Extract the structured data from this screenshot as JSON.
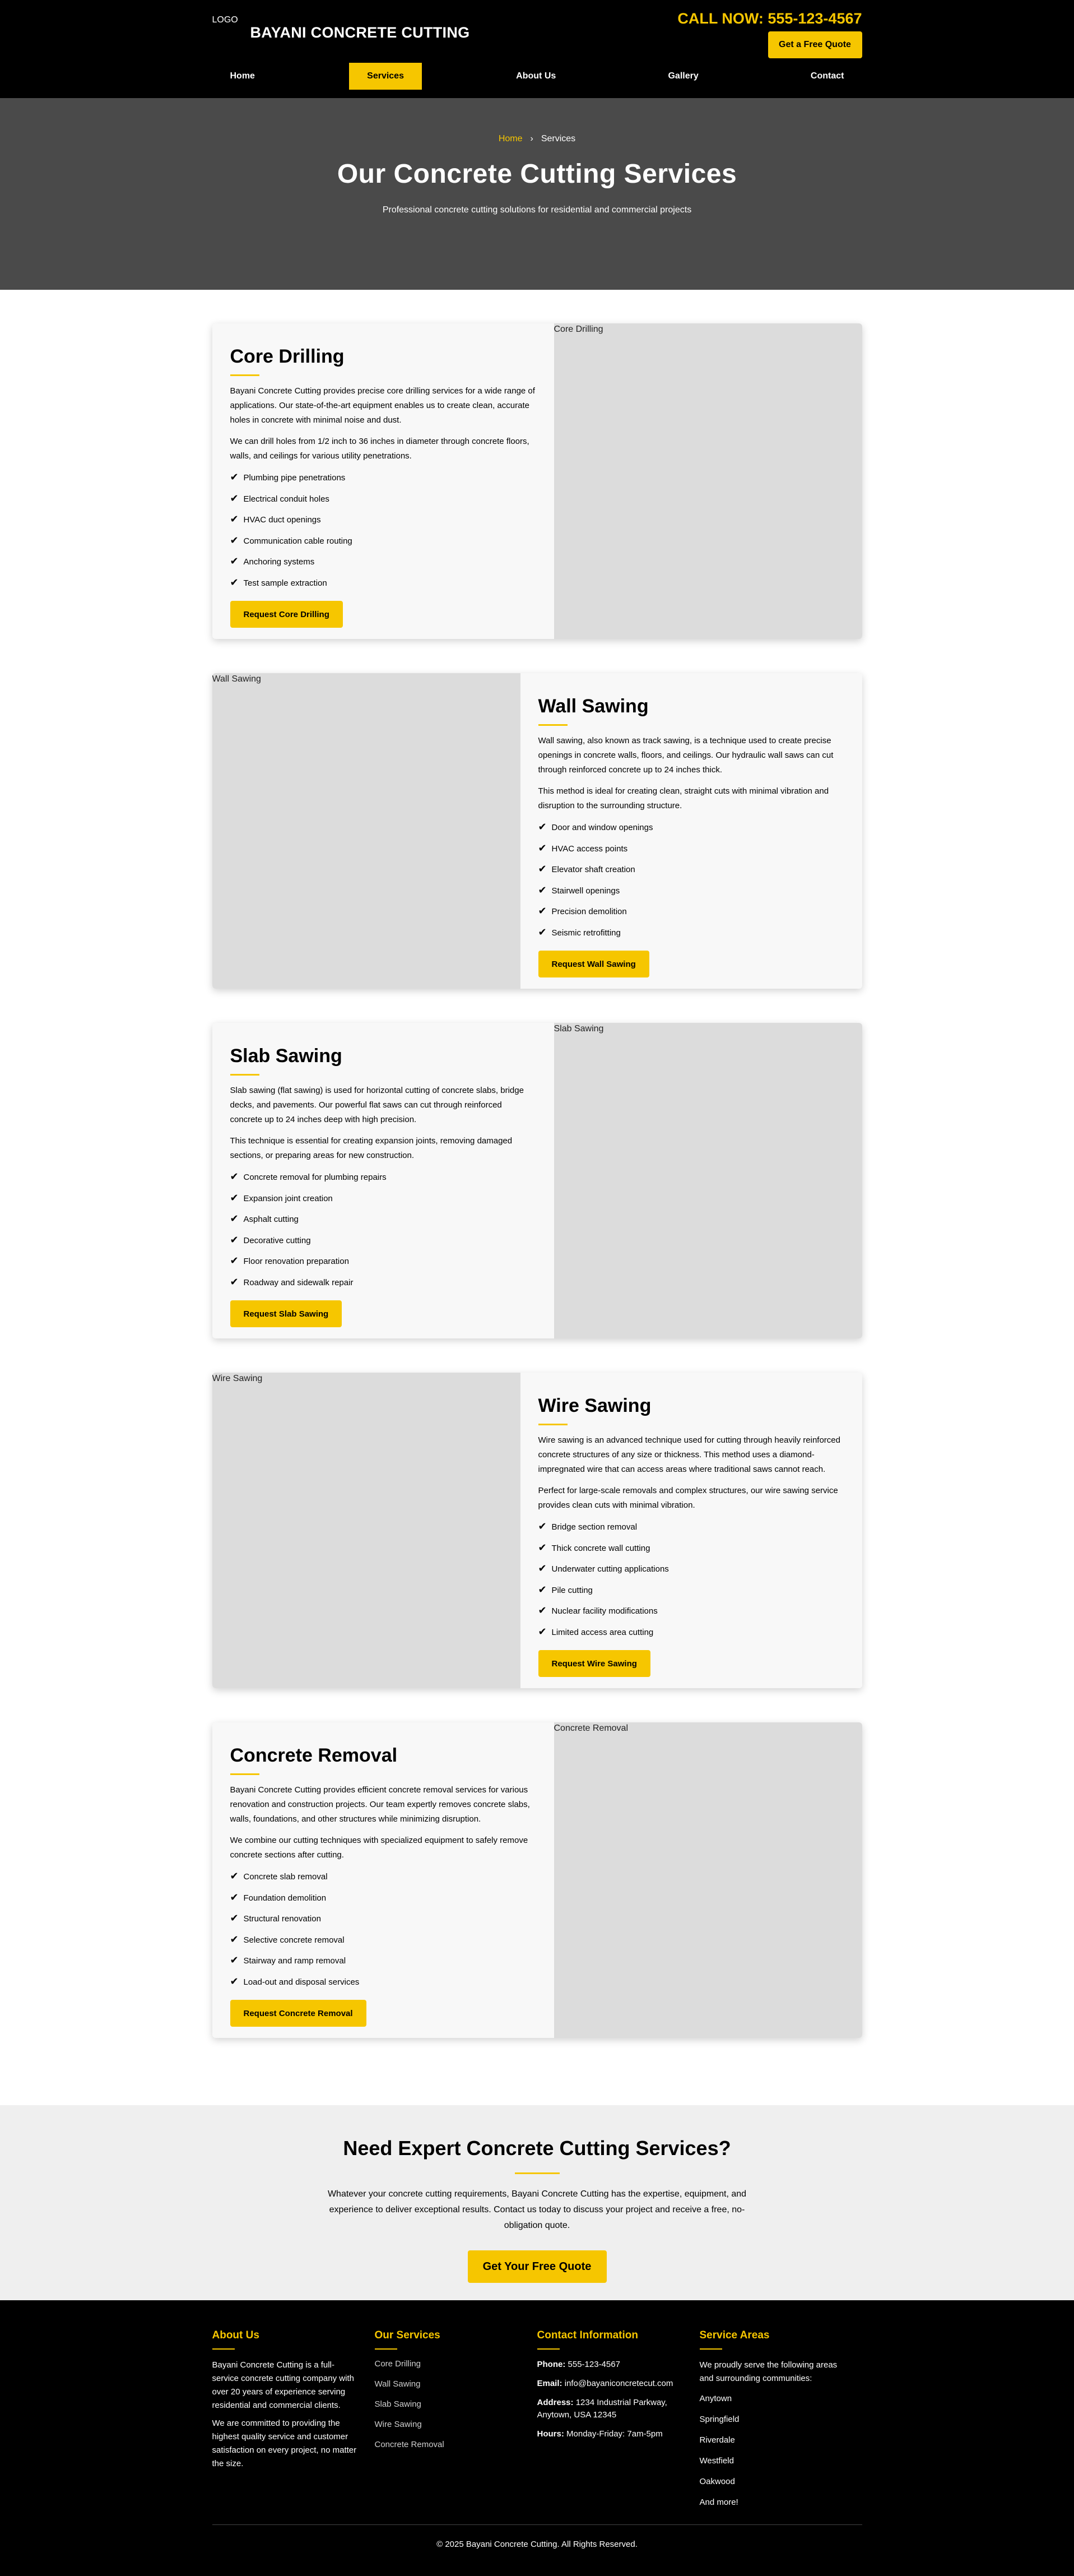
{
  "header": {
    "logo_alt": "LOGO",
    "brand": "BAYANI CONCRETE CUTTING",
    "call": "CALL NOW: 555-123-4567",
    "quote_button": "Get a Free Quote",
    "nav": [
      "Home",
      "Services",
      "About Us",
      "Gallery",
      "Contact"
    ],
    "active_nav": "Services"
  },
  "hero": {
    "breadcrumb_home": "Home",
    "breadcrumb_sep": "›",
    "breadcrumb_current": "Services",
    "title": "Our Concrete Cutting Services",
    "subtitle": "Professional concrete cutting solutions for residential and commercial projects"
  },
  "services": [
    {
      "title": "Core Drilling",
      "image_alt": "Core Drilling",
      "paragraphs": [
        "Bayani Concrete Cutting provides precise core drilling services for a wide range of applications. Our state-of-the-art equipment enables us to create clean, accurate holes in concrete with minimal noise and dust.",
        "We can drill holes from 1/2 inch to 36 inches in diameter through concrete floors, walls, and ceilings for various utility penetrations."
      ],
      "items": [
        "Plumbing pipe penetrations",
        "Electrical conduit holes",
        "HVAC duct openings",
        "Communication cable routing",
        "Anchoring systems",
        "Test sample extraction"
      ],
      "button": "Request Core Drilling"
    },
    {
      "title": "Wall Sawing",
      "image_alt": "Wall Sawing",
      "paragraphs": [
        "Wall sawing, also known as track sawing, is a technique used to create precise openings in concrete walls, floors, and ceilings. Our hydraulic wall saws can cut through reinforced concrete up to 24 inches thick.",
        "This method is ideal for creating clean, straight cuts with minimal vibration and disruption to the surrounding structure."
      ],
      "items": [
        "Door and window openings",
        "HVAC access points",
        "Elevator shaft creation",
        "Stairwell openings",
        "Precision demolition",
        "Seismic retrofitting"
      ],
      "button": "Request Wall Sawing"
    },
    {
      "title": "Slab Sawing",
      "image_alt": "Slab Sawing",
      "paragraphs": [
        "Slab sawing (flat sawing) is used for horizontal cutting of concrete slabs, bridge decks, and pavements. Our powerful flat saws can cut through reinforced concrete up to 24 inches deep with high precision.",
        "This technique is essential for creating expansion joints, removing damaged sections, or preparing areas for new construction."
      ],
      "items": [
        "Concrete removal for plumbing repairs",
        "Expansion joint creation",
        "Asphalt cutting",
        "Decorative cutting",
        "Floor renovation preparation",
        "Roadway and sidewalk repair"
      ],
      "button": "Request Slab Sawing"
    },
    {
      "title": "Wire Sawing",
      "image_alt": "Wire Sawing",
      "paragraphs": [
        "Wire sawing is an advanced technique used for cutting through heavily reinforced concrete structures of any size or thickness. This method uses a diamond-impregnated wire that can access areas where traditional saws cannot reach.",
        "Perfect for large-scale removals and complex structures, our wire sawing service provides clean cuts with minimal vibration."
      ],
      "items": [
        "Bridge section removal",
        "Thick concrete wall cutting",
        "Underwater cutting applications",
        "Pile cutting",
        "Nuclear facility modifications",
        "Limited access area cutting"
      ],
      "button": "Request Wire Sawing"
    },
    {
      "title": "Concrete Removal",
      "image_alt": "Concrete Removal",
      "paragraphs": [
        "Bayani Concrete Cutting provides efficient concrete removal services for various renovation and construction projects. Our team expertly removes concrete slabs, walls, foundations, and other structures while minimizing disruption.",
        "We combine our cutting techniques with specialized equipment to safely remove concrete sections after cutting."
      ],
      "items": [
        "Concrete slab removal",
        "Foundation demolition",
        "Structural renovation",
        "Selective concrete removal",
        "Stairway and ramp removal",
        "Load-out and disposal services"
      ],
      "button": "Request Concrete Removal"
    }
  ],
  "cta": {
    "title": "Need Expert Concrete Cutting Services?",
    "text": "Whatever your concrete cutting requirements, Bayani Concrete Cutting has the expertise, equipment, and experience to deliver exceptional results. Contact us today to discuss your project and receive a free, no-obligation quote.",
    "button": "Get Your Free Quote"
  },
  "footer": {
    "about_title": "About Us",
    "about_p1": "Bayani Concrete Cutting is a full-service concrete cutting company with over 20 years of experience serving residential and commercial clients.",
    "about_p2": "We are committed to providing the highest quality service and customer satisfaction on every project, no matter the size.",
    "services_title": "Our Services",
    "services_links": [
      "Core Drilling",
      "Wall Sawing",
      "Slab Sawing",
      "Wire Sawing",
      "Concrete Removal"
    ],
    "contact_title": "Contact Information",
    "phone_label": "Phone:",
    "phone": "555-123-4567",
    "email_label": "Email:",
    "email": "info@bayaniconcretecut.com",
    "address_label": "Address:",
    "address": "1234 Industrial Parkway, Anytown, USA 12345",
    "hours_label": "Hours:",
    "hours": "Monday-Friday: 7am-5pm",
    "areas_title": "Service Areas",
    "areas_intro": "We proudly serve the following areas and surrounding communities:",
    "areas": [
      "Anytown",
      "Springfield",
      "Riverdale",
      "Westfield",
      "Oakwood",
      "And more!"
    ],
    "copyright": "© 2025 Bayani Concrete Cutting. All Rights Reserved."
  },
  "colors": {
    "accent": "#f6c600",
    "header_bg": "#000000",
    "hero_bg": "#4a4a4a",
    "card_bg": "#f8f8f8",
    "image_placeholder": "#dcdcdc",
    "cta_bg": "#efefef"
  },
  "icons": {
    "list_bullet": "check-icon",
    "breadcrumb_separator": "chevron-right-icon",
    "logo": "broken-image-icon"
  }
}
